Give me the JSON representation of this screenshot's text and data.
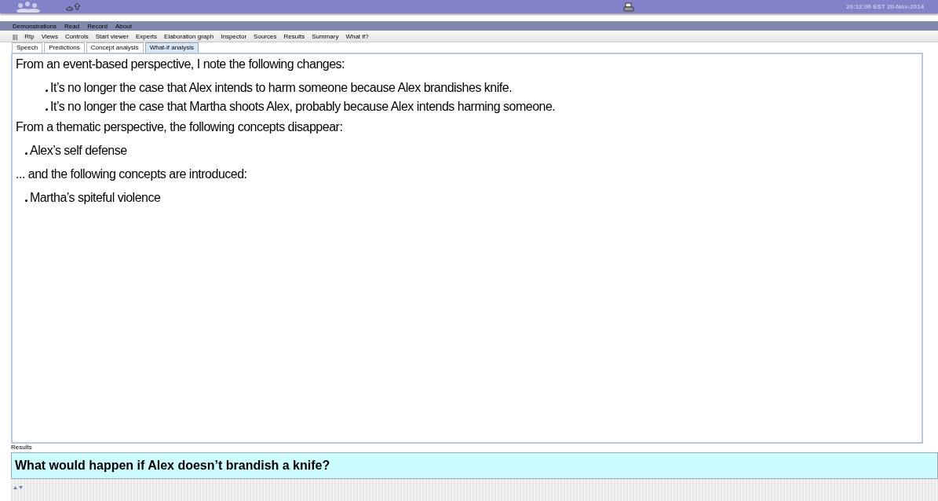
{
  "top_bar": {
    "clock": "20:12:00 EST 20-Nov-2014"
  },
  "menu_bar": [
    "Demonstrations",
    "Read",
    "Record",
    "About"
  ],
  "toolbar": {
    "handle": "|||",
    "items": [
      "Rtp",
      "Views",
      "Controls",
      "Start viewer",
      "Experts",
      "Elaboration graph",
      "Inspector",
      "Sources",
      "Results",
      "Summary",
      "What if?"
    ]
  },
  "tabs": [
    {
      "label": "Speech",
      "selected": false
    },
    {
      "label": "Predictions",
      "selected": false
    },
    {
      "label": "Concept analysis",
      "selected": false
    },
    {
      "label": "What-if analysis",
      "selected": true
    }
  ],
  "content": [
    {
      "kind": "heading",
      "text": "From an event-based perspective, I note the following changes:"
    },
    {
      "kind": "bullet",
      "indent": true,
      "text": "It’s no longer the case that Alex intends to harm someone because Alex brandishes knife."
    },
    {
      "kind": "bullet",
      "indent": true,
      "text": "It’s no longer the case that Martha shoots Alex, probably because Alex intends harming someone."
    },
    {
      "kind": "heading",
      "text": "From a thematic perspective, the following concepts disappear:"
    },
    {
      "kind": "bullet",
      "indent": false,
      "text": "Alex’s self defense"
    },
    {
      "kind": "heading",
      "text": "... and the following concepts are introduced:"
    },
    {
      "kind": "bullet",
      "indent": false,
      "text": "Martha’s spiteful violence"
    }
  ],
  "results_label": "Results",
  "question": {
    "value": "What would happen if Alex doesn’t brandish a knife?"
  }
}
